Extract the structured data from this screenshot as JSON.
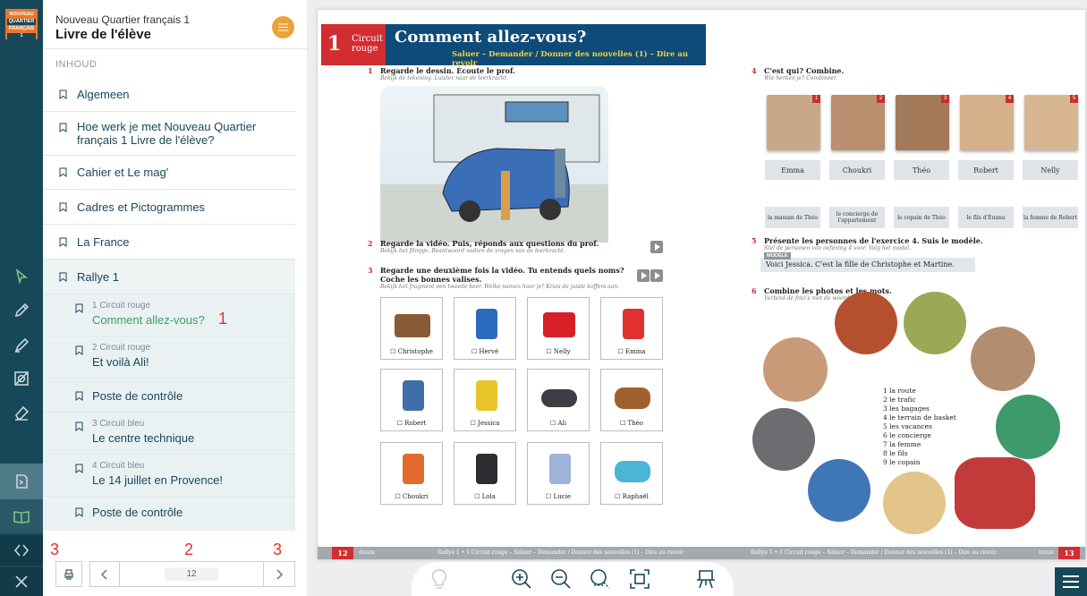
{
  "app": {
    "logo_lines": [
      "NOUVEAU",
      "QUARTIER",
      "FRANÇAIS",
      "1"
    ],
    "subtitle": "Nouveau Quartier français 1",
    "title": "Livre de l'élève",
    "toc_label": "INHOUD"
  },
  "toc": [
    {
      "label": "Algemeen"
    },
    {
      "label": "Hoe werk je met Nouveau Quartier français 1 Livre de l'élève?"
    },
    {
      "label": "Cahier et Le mag'"
    },
    {
      "label": "Cadres et Pictogrammes"
    },
    {
      "label": "La France"
    },
    {
      "label": "Rallye 1"
    },
    {
      "small": "1 Circuit rouge",
      "label": "Comment allez-vous?"
    },
    {
      "small": "2 Circuit rouge",
      "label": "Et voilà Ali!"
    },
    {
      "label": "Poste de contrôle"
    },
    {
      "small": "3 Circuit bleu",
      "label": "Le centre technique"
    },
    {
      "small": "4 Circuit bleu",
      "label": "Le 14 juillet en Provence!"
    },
    {
      "label": "Poste de contrôle"
    }
  ],
  "annotations": {
    "a1": "1",
    "a2": "2",
    "a3l": "3",
    "a3r": "3"
  },
  "pager": {
    "page": "12"
  },
  "book": {
    "unit_num": "1",
    "circuit": "Circuit rouge",
    "title": "Comment allez-vous?",
    "subtitle": "Saluer – Demander / Donner des nouvelles (1) – Dire au revoir",
    "ex1": {
      "n": "1",
      "text": "Regarde le dessin. Écoute le prof.",
      "hint": "Bekijk de tekening. Luister naar de leerkracht."
    },
    "ex2": {
      "n": "2",
      "text": "Regarde la vidéo. Puis, réponds aux questions du prof.",
      "hint": "Bekijk het filmpje. Beantwoord nadien de vragen van de leerkracht."
    },
    "ex3": {
      "n": "3",
      "text": "Regarde une deuxième fois la vidéo. Tu entends quels noms?",
      "text2": "Coche les bonnes valises.",
      "hint": "Bekijk het fragment een tweede keer. Welke namen hoor je? Kruis de juiste koffers aan."
    },
    "bags": [
      "☐ Christophe",
      "☐ Hervé",
      "☐ Nelly",
      "☐ Emma",
      "☐ Robert",
      "☐ Jessica",
      "☐ Ali",
      "☐ Théo",
      "☐ Choukri",
      "☐ Lola",
      "☐ Lucie",
      "☐ Raphaël"
    ],
    "ex4": {
      "n": "4",
      "text": "C'est qui? Combine.",
      "hint": "Wie herken je? Combineer."
    },
    "faces": [
      "1",
      "2",
      "3",
      "4",
      "5"
    ],
    "names": [
      "Emma",
      "Choukri",
      "Théo",
      "Robert",
      "Nelly"
    ],
    "relations": [
      "la maman de Théo",
      "le concierge de l'appartement",
      "le copain de Théo",
      "le fils d'Emma",
      "la femme de Robert"
    ],
    "ex5": {
      "n": "5",
      "text": "Présente les personnes de l'exercice 4. Suis le modèle.",
      "hint": "Stel de personen van oefening 4 voor. Volg het model."
    },
    "modele_tag": "MODÈLE",
    "modele": "Voici Jessica. C'est la fille de Christophe et Martine.",
    "ex6": {
      "n": "6",
      "text": "Combine les photos et les mots.",
      "hint": "Verbind de foto's met de woorden."
    },
    "words": [
      "1   la route",
      "2   le trafic",
      "3   les bagages",
      "4   le terrain de basket",
      "5   les vacances",
      "6   le concierge",
      "7   la femme",
      "8   le fils",
      "9   le copain"
    ],
    "footer_left_num": "12",
    "footer_left_word": "douze",
    "footer_text": "Rallye 1 • 1 Circuit rouge – Saluer – Demander / Donner des nouvelles (1) – Dire au revoir",
    "footer_right_word": "treize",
    "footer_right_num": "13"
  },
  "colors": {
    "rail": "#17485a",
    "accent_green": "#3f9d63",
    "unit_red": "#d22d30",
    "banner_blue": "#0e4b79",
    "menu_orange": "#e9a33a"
  }
}
